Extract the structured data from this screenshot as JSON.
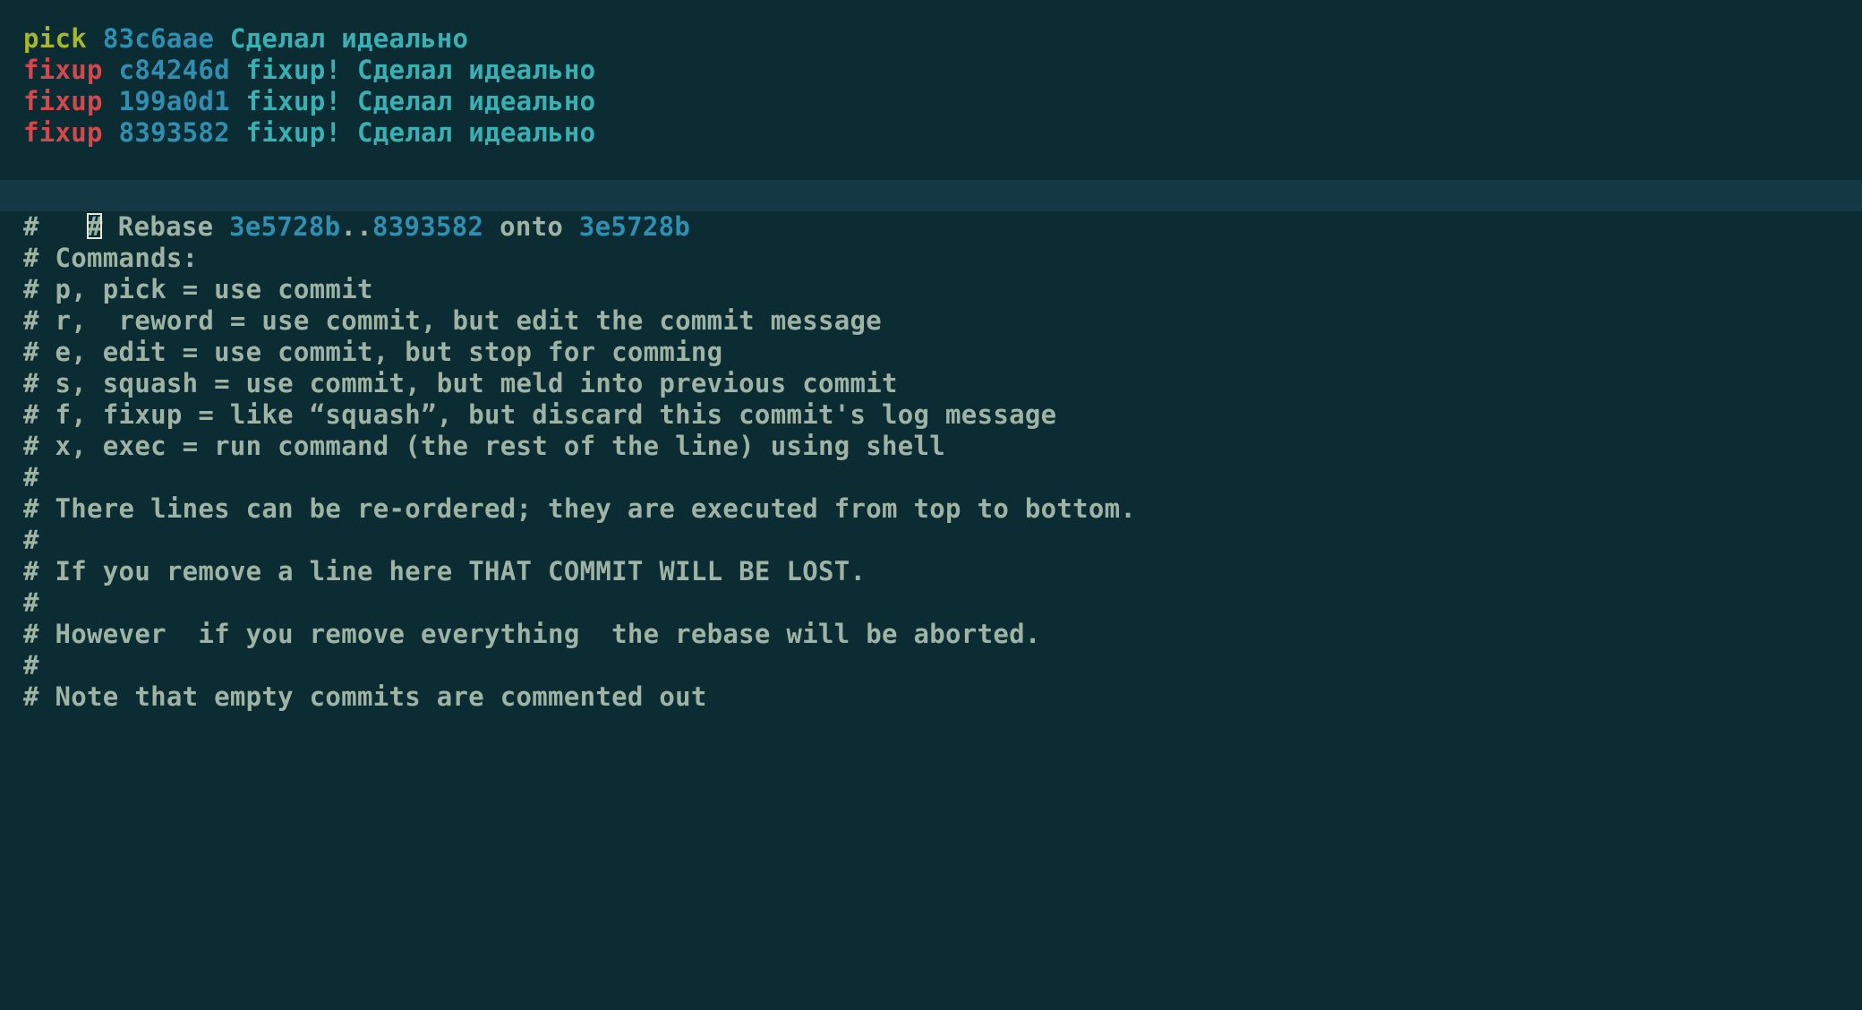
{
  "commits": [
    {
      "cmd": "pick",
      "hash": "83c6aae",
      "msg": "Сделал идеально",
      "cmd_class": "cmd-pick",
      "msg_class": "msg-cyan"
    },
    {
      "cmd": "fixup",
      "hash": "c84246d",
      "msg": "fixup! Сделал идеально",
      "cmd_class": "cmd-fixup",
      "msg_class": "msg-cyan"
    },
    {
      "cmd": "fixup",
      "hash": "199a0d1",
      "msg": "fixup! Сделал идеально",
      "cmd_class": "cmd-fixup",
      "msg_class": "msg-cyan"
    },
    {
      "cmd": "fixup",
      "hash": "8393582",
      "msg": "fixup! Сделал идеально",
      "cmd_class": "cmd-fixup",
      "msg_class": "msg-cyan"
    }
  ],
  "cursor_char": "#",
  "rebase_line": {
    "prefix": " Rebase ",
    "hash1": "3e5728b",
    "dots": "..",
    "hash2": "8393582",
    "onto": " onto ",
    "hash3": "3e5728b"
  },
  "help": {
    "l0": "#",
    "l1": "# Commands:",
    "l2": "# p, pick = use commit",
    "l3": "# r,  reword = use commit, but edit the commit message",
    "l4": "# e, edit = use commit, but stop for comming",
    "l5": "# s, squash = use commit, but meld into previous commit",
    "l6": "# f, fixup = like “squash”, but discard this commit's log message",
    "l7": "# x, exec = run command (the rest of the line) using shell",
    "l8": "#",
    "l9": "# There lines can be re-ordered; they are executed from top to bottom.",
    "l10": "#",
    "l11": "# If you remove a line here THAT COMMIT WILL BE LOST.",
    "l12": "#",
    "l13": "# However  if you remove everything  the rebase will be aborted.",
    "l14": "#",
    "l15": "# Note that empty commits are commented out"
  }
}
